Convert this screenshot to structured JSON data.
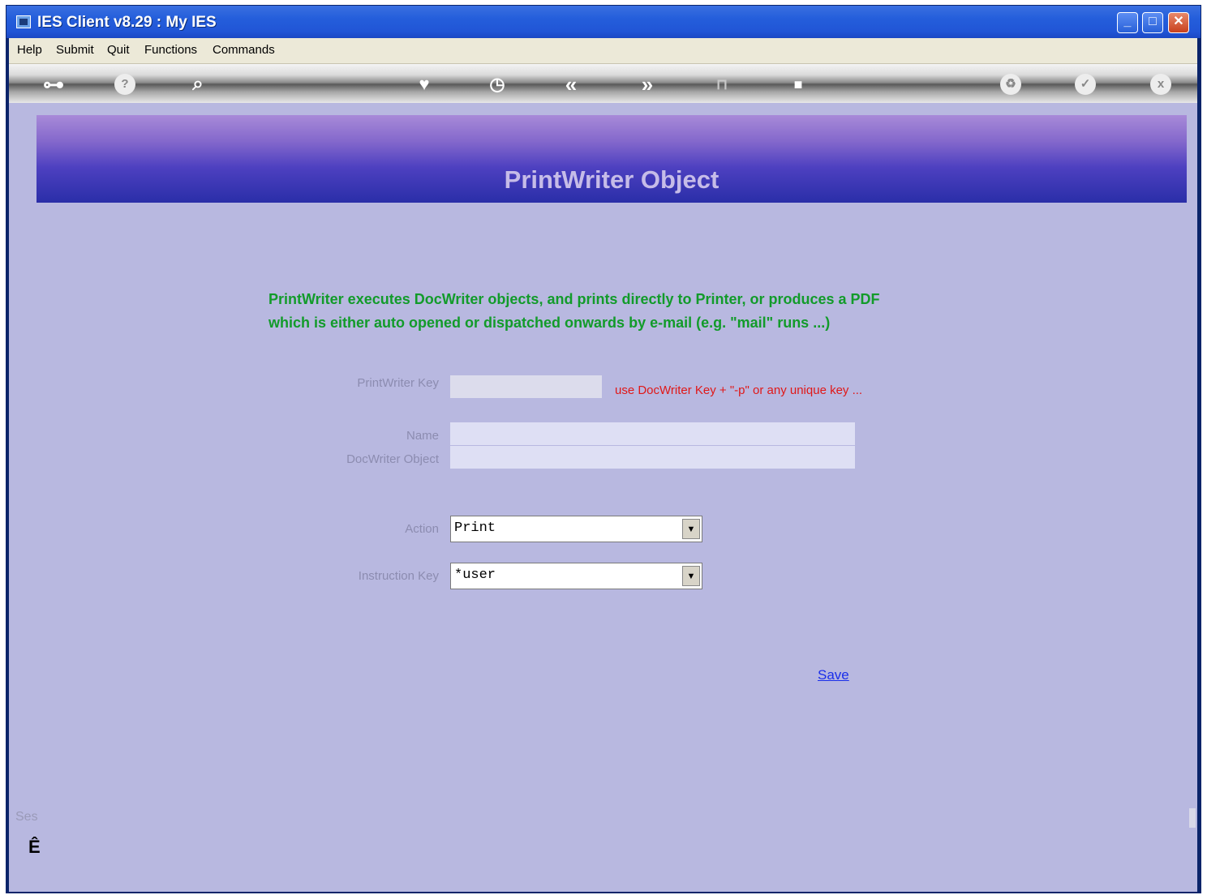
{
  "window": {
    "title": "IES Client v8.29 : My IES",
    "controls": {
      "minimize": "_",
      "maximize": "□",
      "close": "✕"
    }
  },
  "menu": [
    "Help",
    "Submit",
    "Quit",
    "Functions",
    "Commands"
  ],
  "toolbar": {
    "icons": [
      "key-icon",
      "help-icon",
      "search-icon",
      "heart-icon",
      "clock-icon",
      "rewind-icon",
      "fast-forward-icon",
      "trash-icon",
      "stop-icon",
      "recycle-icon",
      "check-icon",
      "close-icon"
    ],
    "glyphs": {
      "key": "⊶",
      "help": "?",
      "search": "⌕",
      "heart": "♥",
      "clock": "◷",
      "rewind": "«",
      "forward": "»",
      "trash": "⊓",
      "stop": "■",
      "recycle": "♻",
      "check": "✓",
      "close": "x"
    }
  },
  "header": {
    "title": "PrintWriter Object"
  },
  "description": {
    "line1": "PrintWriter executes DocWriter objects, and  prints directly to Printer, or produces a PDF",
    "line2": "which is either auto opened or dispatched onwards by e-mail (e.g. \"mail\" runs ...)"
  },
  "form": {
    "printwriter_key": {
      "label": "PrintWriter Key",
      "value": "",
      "hint": "use DocWriter Key + \"-p\" or any unique key ..."
    },
    "name": {
      "label": "Name",
      "value": ""
    },
    "docwriter_object": {
      "label": "DocWriter Object",
      "value": ""
    },
    "action": {
      "label": "Action",
      "value": "Print"
    },
    "instruction_key": {
      "label": "Instruction Key",
      "value": "*user"
    }
  },
  "save_label": "Save",
  "session": {
    "label": "Ses",
    "mark": "Ê"
  },
  "colors": {
    "background": "#b8b8e0",
    "description_text": "#129b2a",
    "hint_text": "#e01818",
    "link": "#1a2eea"
  }
}
